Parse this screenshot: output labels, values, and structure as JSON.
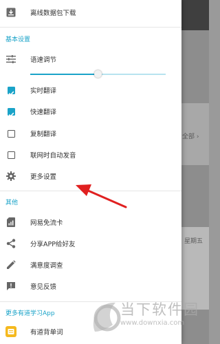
{
  "drawer": {
    "offline_label": "离线数据包下载",
    "basic_section": "基本设置",
    "speed_label": "语速调节",
    "speed_level": 0.5,
    "realtime_label": "实时翻译",
    "realtime_checked": true,
    "quick_label": "快速翻译",
    "quick_checked": true,
    "copy_label": "复制翻译",
    "copy_checked": false,
    "auto_voice_label": "联网时自动发音",
    "auto_voice_checked": false,
    "more_settings_label": "更多设置",
    "other_section": "其他",
    "free_card_label": "网易免流卡",
    "share_label": "分享APP给好友",
    "survey_label": "满意度调查",
    "feedback_label": "意见反馈",
    "more_apps_section": "更多有道学习App",
    "wordbook_label": "有道背单词"
  },
  "background": {
    "all_label": "全部 ›",
    "weekday_label": "星期五"
  },
  "watermark": {
    "brand": "当下软件园",
    "url": "www.downxia.com"
  },
  "colors": {
    "accent": "#1aa3c8",
    "arrow": "#e02020"
  }
}
